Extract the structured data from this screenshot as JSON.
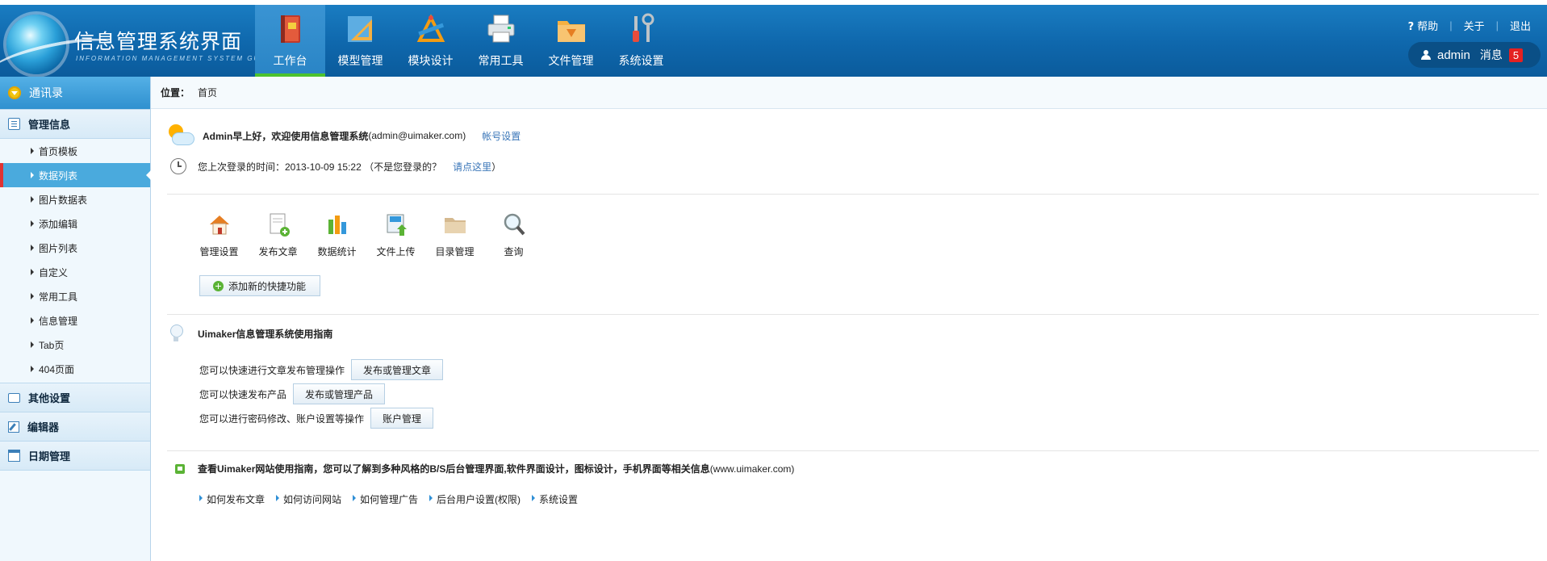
{
  "app": {
    "title": "信息管理系统界面",
    "subtitle": "INFORMATION MANAGEMENT SYSTEM GUI"
  },
  "nav": {
    "items": [
      {
        "label": "工作台",
        "icon": "book-icon",
        "active": true
      },
      {
        "label": "模型管理",
        "icon": "ruler-triangle-icon",
        "active": false
      },
      {
        "label": "模块设计",
        "icon": "design-tools-icon",
        "active": false
      },
      {
        "label": "常用工具",
        "icon": "printer-icon",
        "active": false
      },
      {
        "label": "文件管理",
        "icon": "folder-download-icon",
        "active": false
      },
      {
        "label": "系统设置",
        "icon": "wrench-screwdriver-icon",
        "active": false
      }
    ]
  },
  "top_links": {
    "help": "帮助",
    "about": "关于",
    "logout": "退出"
  },
  "user": {
    "name": "admin",
    "messages_label": "消息",
    "message_count": "5"
  },
  "sidebar": {
    "contacts": "通讯录",
    "manage_info": "管理信息",
    "items": [
      {
        "label": "首页模板"
      },
      {
        "label": "数据列表",
        "active": true
      },
      {
        "label": "图片数据表"
      },
      {
        "label": "添加编辑"
      },
      {
        "label": "图片列表"
      },
      {
        "label": "自定义"
      },
      {
        "label": "常用工具"
      },
      {
        "label": "信息管理"
      },
      {
        "label": "Tab页"
      },
      {
        "label": "404页面"
      }
    ],
    "other_settings": "其他设置",
    "editor": "编辑器",
    "date_manage": "日期管理"
  },
  "breadcrumb": {
    "label": "位置：",
    "current": "首页"
  },
  "welcome": {
    "greeting": "Admin早上好，欢迎使用信息管理系统",
    "email": "(admin@uimaker.com)",
    "account_link": "帐号设置"
  },
  "last_login": {
    "text": "您上次登录的时间：2013-10-09 15:22 （不是您登录的？",
    "link": "请点这里",
    "close": "）"
  },
  "quick": {
    "items": [
      {
        "label": "管理设置",
        "icon": "house-icon"
      },
      {
        "label": "发布文章",
        "icon": "doc-add-icon"
      },
      {
        "label": "数据统计",
        "icon": "bar-chart-icon"
      },
      {
        "label": "文件上传",
        "icon": "upload-icon"
      },
      {
        "label": "目录管理",
        "icon": "folder-icon"
      },
      {
        "label": "查询",
        "icon": "magnifier-icon"
      }
    ],
    "add_label": "添加新的快捷功能"
  },
  "guide": {
    "title": "Uimaker信息管理系统使用指南",
    "rows": [
      {
        "text": "您可以快速进行文章发布管理操作",
        "button": "发布或管理文章"
      },
      {
        "text": "您可以快速发布产品",
        "button": "发布或管理产品"
      },
      {
        "text": "您可以进行密码修改、账户设置等操作",
        "button": "账户管理"
      }
    ]
  },
  "site": {
    "title_bold": "查看Uimaker网站使用指南，您可以了解到多种风格的B/S后台管理界面,软件界面设计，图标设计，手机界面等相关信息",
    "title_url": "(www.uimaker.com)",
    "links": [
      "如何发布文章",
      "如何访问网站",
      "如何管理广告",
      "后台用户设置(权限)",
      "系统设置"
    ]
  }
}
